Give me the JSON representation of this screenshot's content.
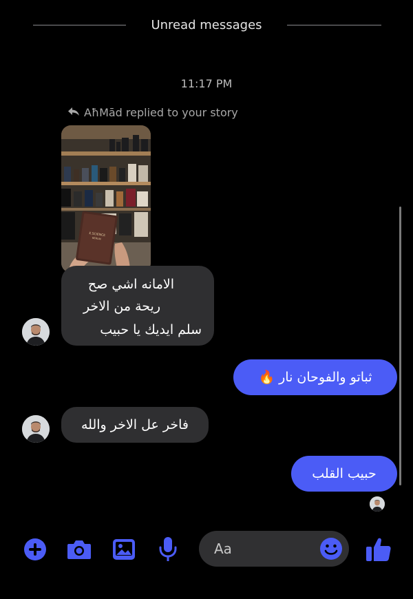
{
  "header": {
    "unread_label": "Unread messages"
  },
  "timestamp": "11:17 PM",
  "story_reply": {
    "text": "AħMād replied to your story"
  },
  "messages": {
    "m1_lines": [
      "الامانه اشي صح",
      "ريحة من الاخر",
      "سلم ايديك يا حبيب"
    ],
    "m2": "ثباتو والفوحان نار 🔥",
    "m3": "فاخر عل الاخر والله",
    "m4": "حبيب القلب"
  },
  "composer": {
    "placeholder": "Aa"
  },
  "icons": [
    "reply-arrow-icon",
    "plus-icon",
    "camera-icon",
    "image-icon",
    "microphone-icon",
    "emoji-icon",
    "thumbs-up-icon"
  ],
  "colors": {
    "accent": "#4b5cf6",
    "incoming_bubble": "#2f2f31",
    "background": "#000000"
  }
}
